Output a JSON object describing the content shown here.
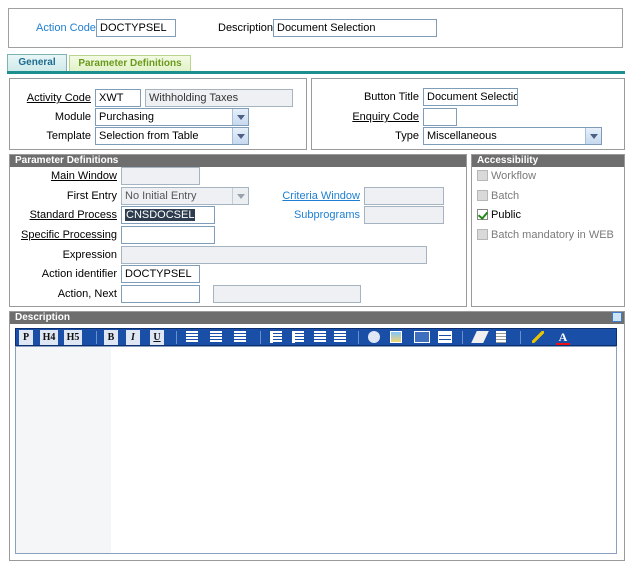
{
  "header": {
    "action_code_label": "Action Code",
    "action_code_value": "DOCTYPSEL",
    "description_label": "Description",
    "description_value": "Document Selection"
  },
  "tabs": [
    {
      "label": "General",
      "active": true
    },
    {
      "label": "Parameter Definitions",
      "active": false
    }
  ],
  "general": {
    "activity_code_label": "Activity Code",
    "activity_code_value": "XWT",
    "activity_code_desc": "Withholding Taxes",
    "module_label": "Module",
    "module_value": "Purchasing",
    "template_label": "Template",
    "template_value": "Selection from Table",
    "button_title_label": "Button Title",
    "button_title_value": "Document Selectio",
    "enquiry_code_label": "Enquiry Code",
    "enquiry_code_value": "",
    "type_label": "Type",
    "type_value": "Miscellaneous"
  },
  "parameter_definitions": {
    "title": "Parameter Definitions",
    "main_window_label": "Main Window",
    "main_window_value": "",
    "first_entry_label": "First Entry",
    "first_entry_value": "No Initial Entry",
    "criteria_window_label": "Criteria Window",
    "criteria_window_value": "",
    "standard_process_label": "Standard Process",
    "standard_process_value": "CNSDOCSEL",
    "subprograms_label": "Subprograms",
    "subprograms_value": "",
    "specific_processing_label": "Specific Processing",
    "specific_processing_value": "",
    "expression_label": "Expression",
    "expression_value": "",
    "action_identifier_label": "Action identifier",
    "action_identifier_value": "DOCTYPSEL",
    "action_next_label": "Action, Next",
    "action_next_value": "",
    "action_next_desc": ""
  },
  "accessibility": {
    "title": "Accessibility",
    "items": [
      {
        "label": "Workflow",
        "checked": false,
        "enabled": false
      },
      {
        "label": "Batch",
        "checked": false,
        "enabled": false
      },
      {
        "label": "Public",
        "checked": true,
        "enabled": true
      },
      {
        "label": "Batch mandatory in WEB",
        "checked": false,
        "enabled": false
      }
    ]
  },
  "description_panel": {
    "title": "Description",
    "toolbar": {
      "p": "P",
      "h4": "H4",
      "h5": "H5",
      "bold": "B",
      "italic": "I",
      "underline": "U",
      "font_color": "A"
    },
    "content": ""
  },
  "colors": {
    "link": "#1e7fd2",
    "panel_header": "#6e6e6e",
    "toolbar_bg": "#1a4fa8",
    "tab_active_text": "#1d6b8f",
    "tab_inactive_text": "#6a9a1b",
    "check_green": "#1f8a12"
  }
}
